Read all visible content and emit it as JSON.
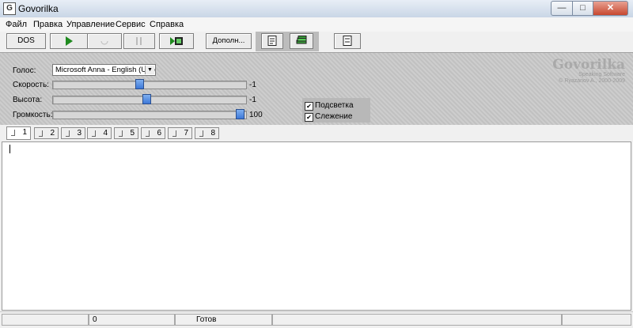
{
  "window": {
    "title": "Govorilka",
    "icon_glyph": "G"
  },
  "menu": [
    "Файл",
    "Правка",
    "Управление",
    "Сервис",
    "Справка"
  ],
  "toolbar": {
    "dos_label": "DOS",
    "more_label": "Дополн..."
  },
  "panel": {
    "voice_label": "Голос:",
    "voice_value": "Microsoft Anna - English (United States)",
    "speed_label": "Скорость:",
    "speed_value": "-1",
    "speed_level": 0.45,
    "pitch_label": "Высота:",
    "pitch_value": "-1",
    "pitch_level": 0.49,
    "volume_label": "Громкость:",
    "volume_value": "100",
    "volume_level": 1.0,
    "highlight_label": "Подсветка",
    "highlight_checked": true,
    "tracking_label": "Слежение",
    "tracking_checked": true
  },
  "brand": {
    "title": "Govorilka",
    "subtitle": "Speaking Software",
    "copyright": "© Ryazanov A., 2000-2009"
  },
  "tabs": [
    "1",
    "2",
    "3",
    "4",
    "5",
    "6",
    "7",
    "8"
  ],
  "status": {
    "position": "0",
    "state": "Готов"
  }
}
